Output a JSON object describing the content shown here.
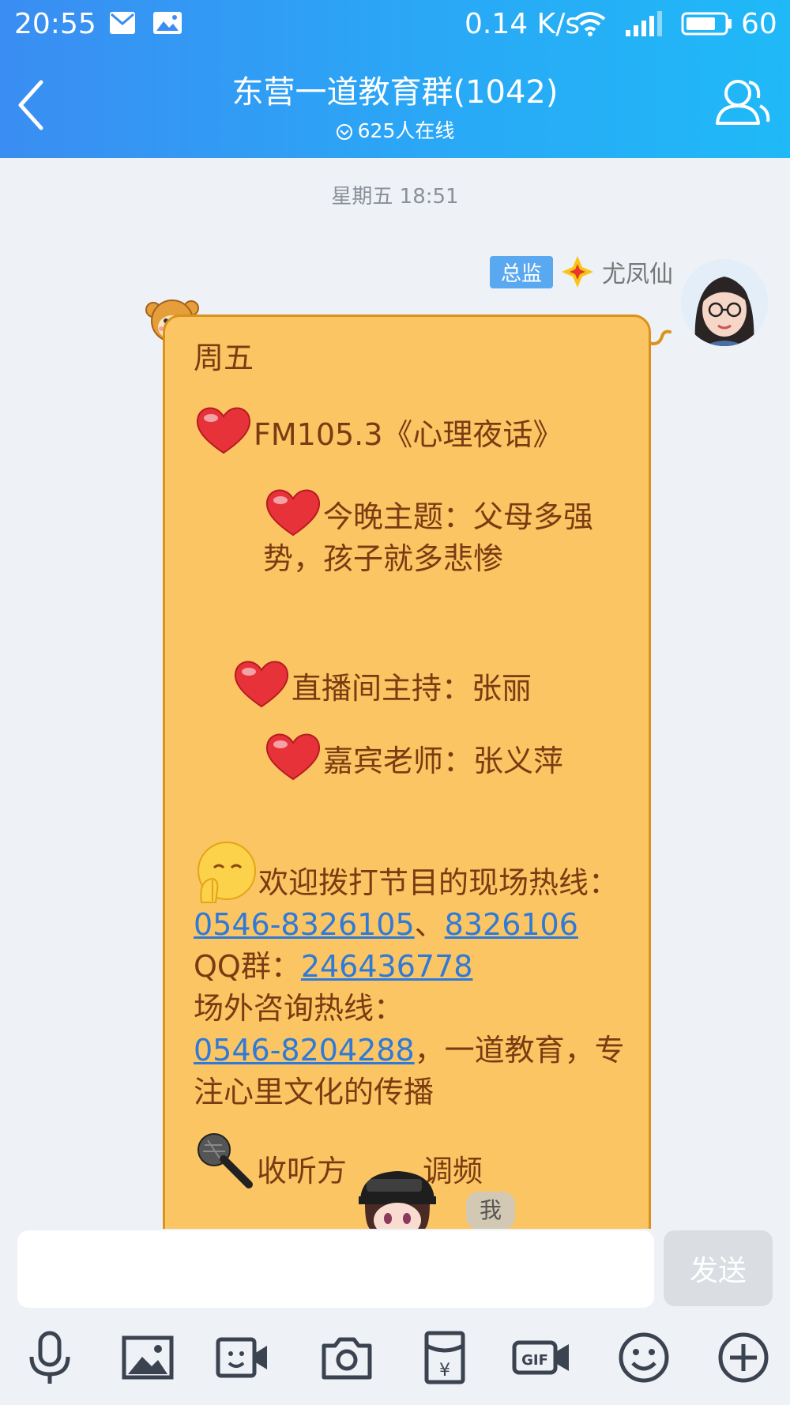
{
  "status_bar": {
    "time": "20:55",
    "network_speed": "0.14 K/s",
    "battery": "60"
  },
  "nav": {
    "title": "东营一道教育群(1042)",
    "online": "625人在线"
  },
  "chat": {
    "timestamp": "星期五 18:51",
    "message": {
      "role_badge": "总监",
      "sender": "尤凤仙",
      "line_day": "周五",
      "line_station": "FM105.3《心理夜话》",
      "line_topic": "今晚主题：父母多强势，孩子就多悲惨",
      "line_host": "直播间主持：张丽",
      "line_guest": "嘉宾老师：张义萍",
      "line_welcome": "欢迎拨打节目的现场热线：",
      "hotline1": "0546-8326105",
      "sep": "、",
      "hotline2": "8326106",
      "qq_label": " QQ群：",
      "qq_number": "246436778",
      "consult_label": "场外咨询热线：",
      "consult_number": "0546-8204288",
      "closing": "，一道教育，专注心里文化的传播",
      "listen_a": "收听方",
      "listen_b": "调频",
      "me_label": "我"
    }
  },
  "input_bar": {
    "send_label": "发送",
    "tools": [
      "microphone-icon",
      "image-icon",
      "video-icon",
      "camera-icon",
      "red-packet-icon",
      "gif-icon",
      "emoji-icon",
      "plus-icon"
    ]
  },
  "colors": {
    "header_gradient_start": "#3a8df2",
    "header_gradient_end": "#1fb9f7",
    "bubble": "#fbc563",
    "bubble_text": "#7a3b12",
    "link": "#2f7ad8",
    "role_badge": "#5aa8f0"
  }
}
